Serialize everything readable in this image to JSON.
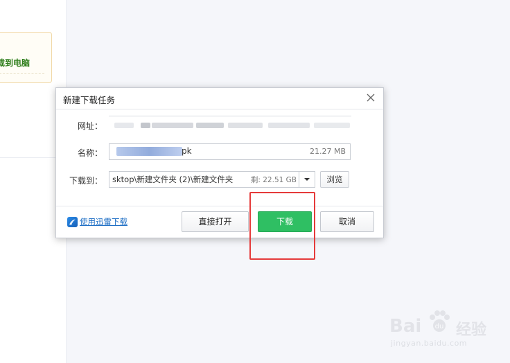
{
  "background": {
    "left_card_text": "载到电脑"
  },
  "dialog": {
    "title": "新建下载任务",
    "url_label": "网址：",
    "name_label": "名称：",
    "name_value": "pk",
    "name_size": "21.27 MB",
    "path_label": "下载到：",
    "path_value": "sktop\\新建文件夹 (2)\\新建文件夹",
    "path_free": "剩: 22.51 GB",
    "browse_label": "浏览",
    "thunder_link": "使用迅雷下载",
    "open_label": "直接打开",
    "download_label": "下载",
    "cancel_label": "取消"
  },
  "watermark": {
    "brand": "Bai",
    "brand_tail": "经验",
    "url": "jingyan.baidu.com"
  },
  "colors": {
    "download_button": "#2fbf63",
    "highlight": "#e53a3a",
    "link": "#1f6fc5"
  },
  "icons": {
    "close": "close-icon",
    "dropdown": "triangle-down-icon",
    "thunder": "thunder-icon",
    "paw": "paw-icon"
  }
}
